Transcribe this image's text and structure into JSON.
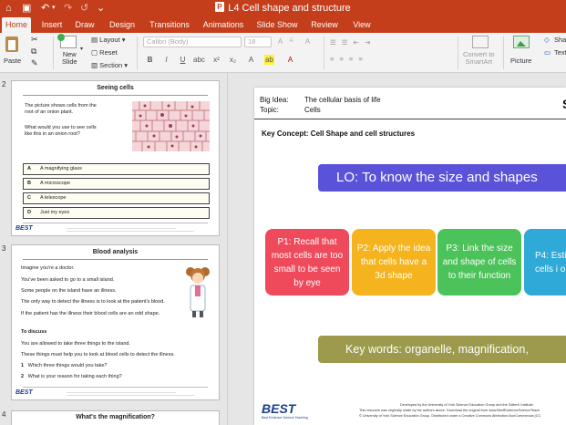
{
  "window": {
    "title": "L4 Cell shape and structure"
  },
  "quick_access": [
    "home-icon",
    "save-icon",
    "undo-icon",
    "redo-icon",
    "repeat-icon",
    "customize-icon"
  ],
  "tabs": [
    "Home",
    "Insert",
    "Draw",
    "Design",
    "Transitions",
    "Animations",
    "Slide Show",
    "Review",
    "View"
  ],
  "active_tab": "Home",
  "ribbon": {
    "paste": "Paste",
    "new_slide": "New\nSlide",
    "layout": "Layout",
    "reset": "Reset",
    "section": "Section",
    "font_name": "Calibri (Body)",
    "font_size": "18",
    "convert": "Convert to\nSmartArt",
    "picture": "Picture",
    "shapes_partial": "Sha",
    "text_partial": "Text"
  },
  "slides_panel": {
    "slide2": {
      "number": "2",
      "title": "Seeing cells",
      "intro1": "The picture shows cells from the",
      "intro2": "root of an onion plant.",
      "question1": "What would you use to see cells",
      "question2": "like this in an onion root?",
      "options": [
        {
          "letter": "A",
          "text": "A magnifying glass"
        },
        {
          "letter": "B",
          "text": "A microscope"
        },
        {
          "letter": "C",
          "text": "A telescope"
        },
        {
          "letter": "D",
          "text": "Just my eyes"
        }
      ],
      "logo": "BEST"
    },
    "slide3": {
      "number": "3",
      "title": "Blood analysis",
      "lines": [
        "Imagine you're a doctor.",
        "You've been asked to go to a small island.",
        "Some people on the island have an illness.",
        "The only way to detect the illness is to look at the patient's blood.",
        "If the patient has the illness their blood cells are an odd shape."
      ],
      "discuss_heading": "To discuss",
      "discuss_lines": [
        "You are allowed to take three things to the island.",
        "These things must help you to look at blood cells to detect the illness."
      ],
      "questions": [
        {
          "n": "1",
          "text": "Which three things would you take?"
        },
        {
          "n": "2",
          "text": "What is your reason for taking each thing?"
        }
      ],
      "logo": "BEST"
    },
    "slide4": {
      "number": "4",
      "title": "What's the magnification?"
    }
  },
  "slide": {
    "big_idea_label": "Big Idea:",
    "big_idea": "The cellular basis of life",
    "topic_label": "Topic:",
    "topic": "Cells",
    "key_concept": "Key Concept: Cell Shape and cell structures",
    "lo": "LO: To know the size and shapes",
    "boxes": [
      {
        "text": "P1: Recall that most cells are too small to be seen by eye",
        "color": "#ee4a5c"
      },
      {
        "text": "P2: Apply the idea that cells have a 3d shape",
        "color": "#f5b41e"
      },
      {
        "text": "P3: Link the size and shape of cells to their function",
        "color": "#4cc25a"
      },
      {
        "text": "P4: Esti the num cells i organ",
        "color": "#2ea9d8"
      }
    ],
    "keywords": "Key words: organelle, magnification,",
    "logo": "BEST",
    "logo_sub": "Best Evidence Science Teaching",
    "footer1": "Developed by the University of York Science Education Group and the Salters' Institute.",
    "footer2": "This resource was originally made by the authors above. Download the original from www.BestEvidenceScienceTeach",
    "footer3": "© University of York Science Education Group. Distributed under a Creative Commons Attribution-NonCommercial (CC"
  }
}
